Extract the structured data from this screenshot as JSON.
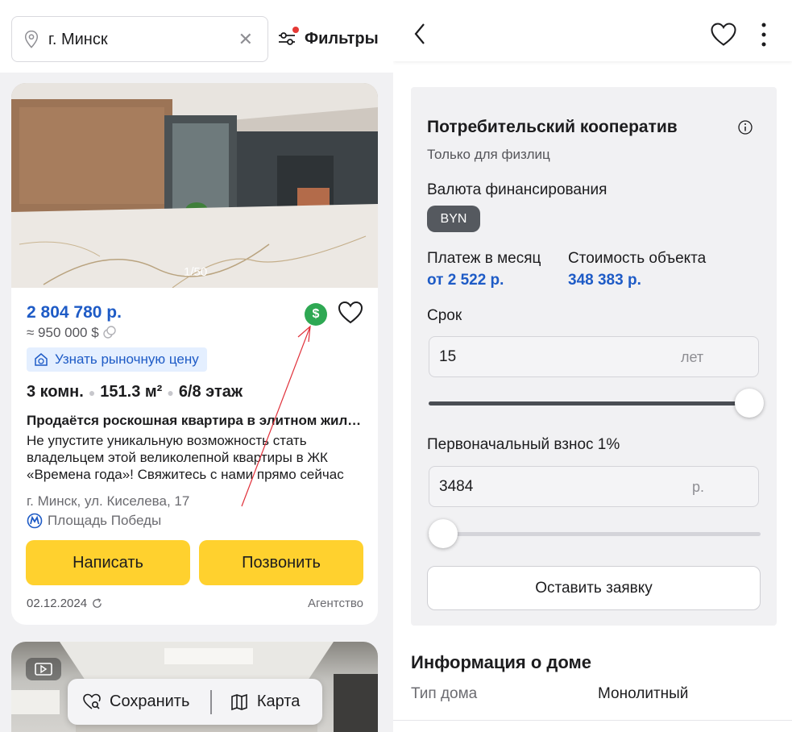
{
  "left": {
    "search": {
      "city": "г. Минск"
    },
    "filters_label": "Фильтры",
    "listing": {
      "photo_counter": "1/50",
      "price": "2 804 780 р.",
      "price_usd": "≈ 950 000 $",
      "market_price_label": "Узнать рыночную цену",
      "params": {
        "rooms": "3 комн.",
        "area": "151.3 м²",
        "floor": "6/8 этаж"
      },
      "title": "Продаётся роскошная квартира в элитном жилом комплексе",
      "description": "Не упустите уникальную возможность стать владельцем этой великолепной квартиры в ЖК «Времена года»! Свяжитесь с нами прямо сейчас",
      "address": "г. Минск, ул. Киселева, 17",
      "metro": "Площадь Победы",
      "write_button": "Написать",
      "call_button": "Позвонить",
      "date": "02.12.2024",
      "seller_type": "Агентство"
    },
    "bottom_bar": {
      "save_label": "Сохранить",
      "map_label": "Карта"
    }
  },
  "right": {
    "financing": {
      "title": "Потребительский кооператив",
      "subtitle": "Только для физлиц",
      "currency_label": "Валюта финансирования",
      "currency": "BYN",
      "monthly_label": "Платеж в месяц",
      "monthly_value": "от 2 522 р.",
      "cost_label": "Стоимость объекта",
      "cost_value": "348 383 р.",
      "term_label": "Срок",
      "term_value": "15",
      "term_unit": "лет",
      "term_slider_fraction": 1.0,
      "down_payment_label": "Первоначальный взнос 1%",
      "down_payment_value": "3484",
      "down_payment_unit": "р.",
      "down_payment_slider_fraction": 0.0,
      "submit_label": "Оставить заявку"
    },
    "house": {
      "heading": "Информация о доме",
      "type_label": "Тип дома",
      "type_value": "Монолитный"
    }
  },
  "colors": {
    "accent_blue": "#1e5bc6",
    "button_yellow": "#ffd12e",
    "badge_green": "#2ea853",
    "annotation_red": "#e0303a"
  }
}
